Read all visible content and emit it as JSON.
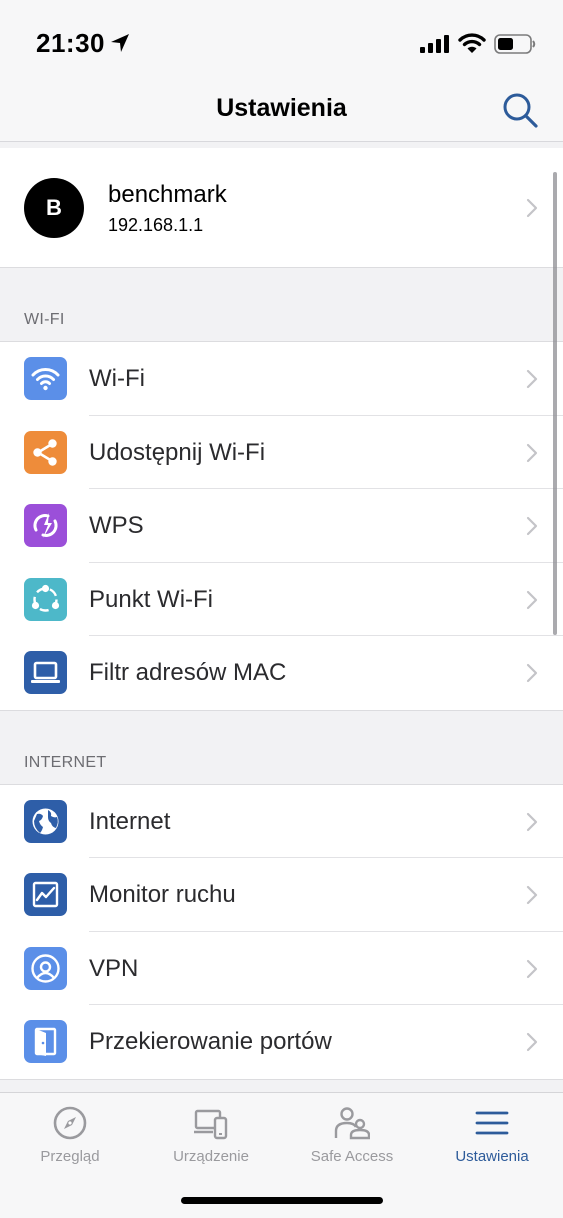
{
  "status_bar": {
    "time": "21:30",
    "icons": [
      "location-arrow-icon",
      "cellular-signal-icon",
      "wifi-icon",
      "battery-icon"
    ]
  },
  "header": {
    "title": "Ustawienia",
    "search_icon": "search-icon"
  },
  "account": {
    "avatar_letter": "B",
    "name": "benchmark",
    "ip": "192.168.1.1"
  },
  "sections": [
    {
      "title": "WI-FI",
      "items": [
        {
          "label": "Wi-Fi",
          "icon": "wifi-icon",
          "color": "#5b8fe8"
        },
        {
          "label": "Udostępnij Wi-Fi",
          "icon": "share-icon",
          "color": "#ee8c3a"
        },
        {
          "label": "WPS",
          "icon": "wps-icon",
          "color": "#9b4fd9"
        },
        {
          "label": "Punkt Wi-Fi",
          "icon": "mesh-point-icon",
          "color": "#4db8c9"
        },
        {
          "label": "Filtr adresów MAC",
          "icon": "laptop-icon",
          "color": "#2e5ea8"
        }
      ]
    },
    {
      "title": "INTERNET",
      "items": [
        {
          "label": "Internet",
          "icon": "globe-icon",
          "color": "#2e5ea8"
        },
        {
          "label": "Monitor ruchu",
          "icon": "traffic-chart-icon",
          "color": "#2e5ea8"
        },
        {
          "label": "VPN",
          "icon": "vpn-icon",
          "color": "#5b8fe8"
        },
        {
          "label": "Przekierowanie portów",
          "icon": "door-icon",
          "color": "#5b8fe8"
        }
      ]
    }
  ],
  "tab_bar": {
    "active": "Ustawienia",
    "tabs": [
      {
        "label": "Przegląd",
        "icon": "compass-icon"
      },
      {
        "label": "Urządzenie",
        "icon": "devices-icon"
      },
      {
        "label": "Safe Access",
        "icon": "family-icon"
      },
      {
        "label": "Ustawienia",
        "icon": "menu-icon"
      }
    ]
  },
  "colors": {
    "accent": "#2d5b9a",
    "inactive_tab": "#9a9a9e",
    "background": "#f2f2f4"
  }
}
